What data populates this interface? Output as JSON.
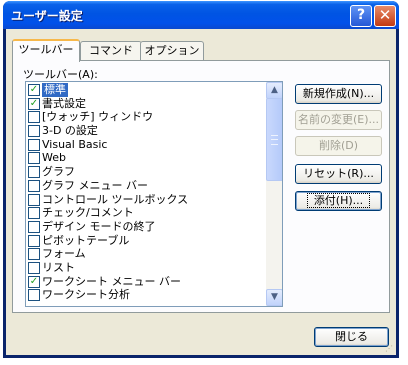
{
  "window": {
    "title": "ユーザー設定"
  },
  "tabs": [
    {
      "label": "ツールバー",
      "active": true
    },
    {
      "label": "コマンド",
      "active": false
    },
    {
      "label": "オプション",
      "active": false
    }
  ],
  "list_label": "ツールバー(A):",
  "toolbars": [
    {
      "label": "標準",
      "checked": true,
      "selected": true
    },
    {
      "label": "書式設定",
      "checked": true
    },
    {
      "label": "[ウォッチ] ウィンドウ",
      "checked": false
    },
    {
      "label": "3-D の設定",
      "checked": false
    },
    {
      "label": "Visual Basic",
      "checked": false
    },
    {
      "label": "Web",
      "checked": false
    },
    {
      "label": "グラフ",
      "checked": false
    },
    {
      "label": "グラフ メニュー バー",
      "checked": false
    },
    {
      "label": "コントロール ツールボックス",
      "checked": false
    },
    {
      "label": "チェック/コメント",
      "checked": false
    },
    {
      "label": "デザイン モードの終了",
      "checked": false
    },
    {
      "label": "ピボットテーブル",
      "checked": false
    },
    {
      "label": "フォーム",
      "checked": false
    },
    {
      "label": "リスト",
      "checked": false
    },
    {
      "label": "ワークシート メニュー バー",
      "checked": true
    },
    {
      "label": "ワークシート分析",
      "checked": false
    }
  ],
  "buttons": {
    "new": "新規作成(N)...",
    "rename": "名前の変更(E)...",
    "delete": "削除(D)",
    "reset": "リセット(R)...",
    "attach": "添付(H)...",
    "close": "閉じる"
  },
  "colors": {
    "titlebar": "#0054e3",
    "selection": "#316ac5",
    "checkmark": "#21a121",
    "dialog_bg": "#ece9d8"
  }
}
